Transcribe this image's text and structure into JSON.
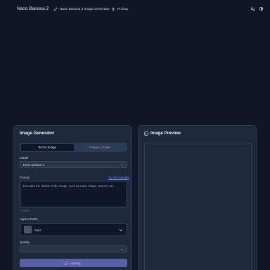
{
  "header": {
    "brand": "Nano Banana 2",
    "nav": [
      {
        "label": "Nano Banana 2 Image Generator",
        "icon": "link-icon"
      },
      {
        "label": "Pricing",
        "icon": "dollar-icon"
      }
    ]
  },
  "generator": {
    "title": "Image Generator",
    "tabs": [
      {
        "label": "Text to Image",
        "active": true
      },
      {
        "label": "Image to Image",
        "active": false
      }
    ],
    "model": {
      "label": "Model",
      "value": "Nano Banana 2"
    },
    "prompt": {
      "label": "Prompt",
      "try_example": "Try an example",
      "placeholder": "Describe the details of the image, such as color, shape, texture, etc.",
      "counter": "0 / 5000"
    },
    "aspect_ratio": {
      "label": "Aspect Ratio",
      "value": "Auto"
    },
    "quality": {
      "label": "Quality",
      "value": ""
    },
    "submit": {
      "label": "Loading..."
    }
  },
  "preview": {
    "title": "Image Preview"
  },
  "colors": {
    "background": "#101828",
    "panel": "#1e293b",
    "accent": "#5861a6",
    "link": "#7c8cff"
  }
}
